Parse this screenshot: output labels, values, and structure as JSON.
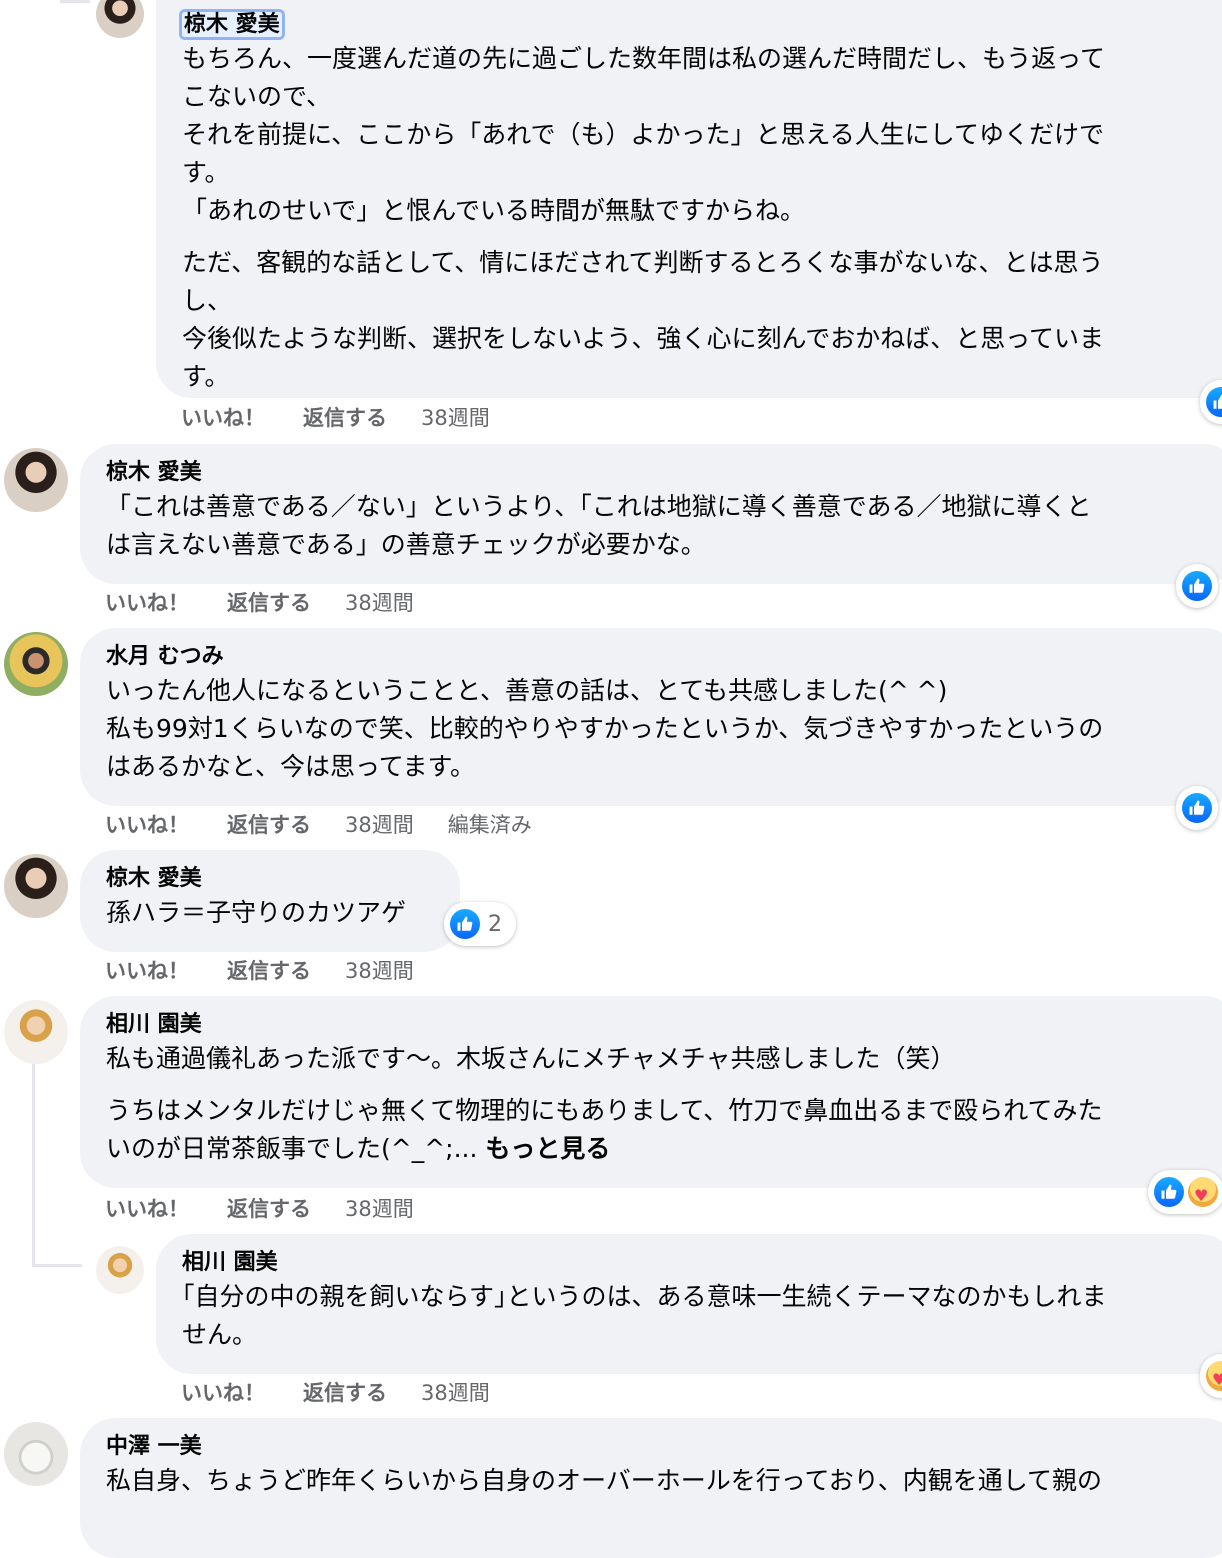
{
  "comments": [
    {
      "author": "椋木 愛美",
      "paragraphs": [
        "もちろん、一度選んだ道の先に過ごした数年間は私の選んだ時間だし、もう返って\nこないので、\nそれを前提に、ここから「あれで（も）よかった」と思える人生にしてゆくだけで\nす。\n「あれのせいで」と恨んでいる時間が無駄ですからね。",
        "ただ、客観的な話として、情にほだされて判断するとろくな事がないな、とは思う\nし、\n今後似たような判断、選択をしないよう、強く心に刻んでおかねば、と思っていま\nす。"
      ],
      "like": "いいね！",
      "reply": "返信する",
      "time": "38週間"
    },
    {
      "author": "椋木 愛美",
      "paragraphs": [
        "「これは善意である／ない」というより、「これは地獄に導く善意である／地獄に導くと\nは言えない善意である」の善意チェックが必要かな。"
      ],
      "like": "いいね！",
      "reply": "返信する",
      "time": "38週間"
    },
    {
      "author": "水月 むつみ",
      "paragraphs": [
        "いったん他人になるということと、善意の話は、とても共感しました(^ ^)\n私も99対1くらいなので笑、比較的やりやすかったというか、気づきやすかったというの\nはあるかなと、今は思ってます。"
      ],
      "like": "いいね！",
      "reply": "返信する",
      "time": "38週間",
      "edited": "編集済み"
    },
    {
      "author": "椋木 愛美",
      "paragraphs": [
        "孫ハラ＝子守りのカツアゲ"
      ],
      "like": "いいね！",
      "reply": "返信する",
      "time": "38週間",
      "reaction_count": "2"
    },
    {
      "author": "相川 園美",
      "paragraphs": [
        "私も通過儀礼あった派です〜。木坂さんにメチャメチャ共感しました（笑）",
        "うちはメンタルだけじゃ無くて物理的にもありまして、竹刀で鼻血出るまで殴られてみた\nいのが日常茶飯事でした(^_^;... "
      ],
      "see_more": "もっと見る",
      "like": "いいね！",
      "reply": "返信する",
      "time": "38週間"
    },
    {
      "author": "相川 園美",
      "paragraphs": [
        "｢自分の中の親を飼いならす｣というのは、ある意味一生続くテーマなのかもしれま\nせん。"
      ],
      "like": "いいね！",
      "reply": "返信する",
      "time": "38週間"
    },
    {
      "author": "中澤 一美",
      "paragraphs": [
        "私自身、ちょうど昨年くらいから自身のオーバーホールを行っており、内観を通して親の"
      ]
    }
  ],
  "colors": {
    "bubble": "#f0f2f5",
    "like_blue": "#0866ff",
    "meta_gray": "#65676b"
  }
}
